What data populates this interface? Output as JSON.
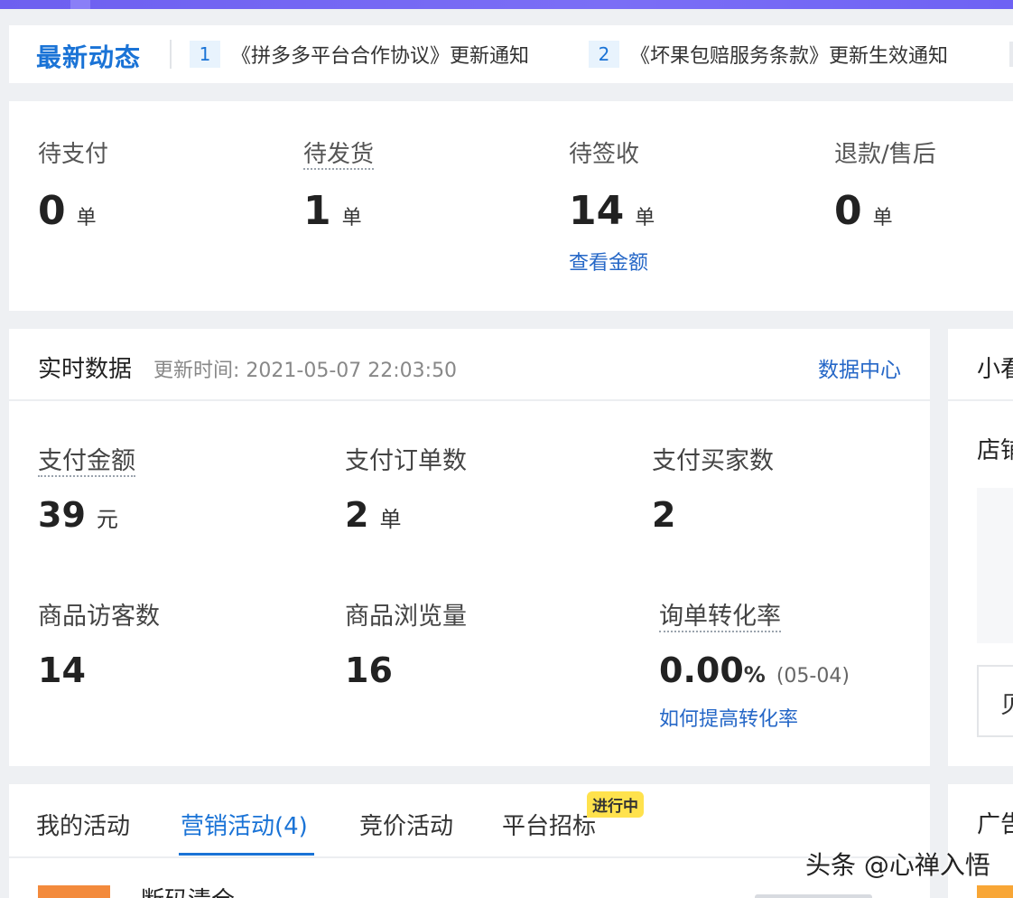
{
  "news": {
    "title": "最新动态",
    "items": [
      {
        "num": "1",
        "text": "《拼多多平台合作协议》更新通知"
      },
      {
        "num": "2",
        "text": "《坏果包赔服务条款》更新生效通知"
      }
    ]
  },
  "orders": [
    {
      "label": "待支付",
      "value": "0",
      "unit": "单"
    },
    {
      "label": "待发货",
      "value": "1",
      "unit": "单"
    },
    {
      "label": "待签收",
      "value": "14",
      "unit": "单",
      "link": "查看金额"
    },
    {
      "label": "退款/售后",
      "value": "0",
      "unit": "单"
    }
  ],
  "realtime": {
    "title": "实时数据",
    "update_time": "更新时间: 2021-05-07 22:03:50",
    "data_center": "数据中心",
    "stats": [
      {
        "label": "支付金额",
        "value": "39",
        "unit": "元"
      },
      {
        "label": "支付订单数",
        "value": "2",
        "unit": "单"
      },
      {
        "label": "支付买家数",
        "value": "2"
      },
      {
        "label": "商品访客数",
        "value": "14"
      },
      {
        "label": "商品浏览量",
        "value": "16"
      },
      {
        "label": "询单转化率",
        "value": "0.00",
        "unit": "%",
        "date": "(05-04)",
        "link": "如何提高转化率"
      }
    ]
  },
  "side_panel": {
    "title": "小看",
    "label": "店铺",
    "button": "贝"
  },
  "activities": {
    "tabs": [
      "我的活动",
      "营销活动(4)",
      "竞价活动",
      "平台招标"
    ],
    "badge": "进行中",
    "item_name": "断码清仓"
  },
  "side_panel2": {
    "title": "广告"
  },
  "watermark": "头条 @心禅入悟",
  "colors": {
    "accent": "#1a73d6",
    "link": "#2567c7",
    "badge": "#ffe24d",
    "top_bar": "#6d5ff0"
  }
}
